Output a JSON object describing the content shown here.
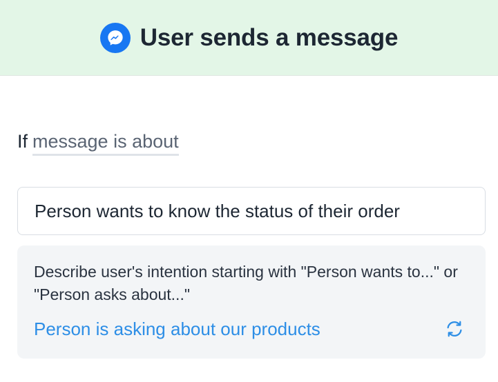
{
  "header": {
    "icon": "messenger-icon",
    "title": "User sends a message",
    "background": "#e3f6e7",
    "icon_color": "#1877f2"
  },
  "condition": {
    "if_label": "If",
    "field_label": "message is about"
  },
  "intent_input": {
    "value": "Person wants to know the status of their order"
  },
  "hint": {
    "text": "Describe user's intention starting with \"Person wants to...\" or \"Person asks about...\"",
    "suggestion": "Person is asking about our products",
    "suggestion_color": "#2d8ee6",
    "refresh_icon": "refresh-icon"
  }
}
